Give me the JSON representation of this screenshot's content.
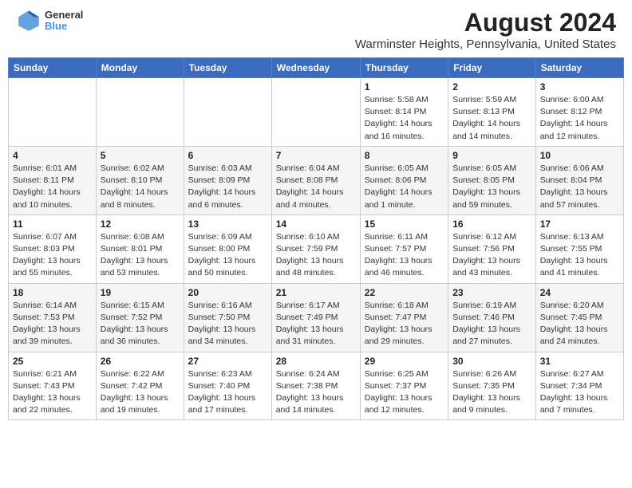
{
  "header": {
    "logo_line1": "General",
    "logo_line2": "Blue",
    "main_title": "August 2024",
    "subtitle": "Warminster Heights, Pennsylvania, United States"
  },
  "calendar": {
    "days_of_week": [
      "Sunday",
      "Monday",
      "Tuesday",
      "Wednesday",
      "Thursday",
      "Friday",
      "Saturday"
    ],
    "weeks": [
      [
        {
          "day": "",
          "info": ""
        },
        {
          "day": "",
          "info": ""
        },
        {
          "day": "",
          "info": ""
        },
        {
          "day": "",
          "info": ""
        },
        {
          "day": "1",
          "info": "Sunrise: 5:58 AM\nSunset: 8:14 PM\nDaylight: 14 hours\nand 16 minutes."
        },
        {
          "day": "2",
          "info": "Sunrise: 5:59 AM\nSunset: 8:13 PM\nDaylight: 14 hours\nand 14 minutes."
        },
        {
          "day": "3",
          "info": "Sunrise: 6:00 AM\nSunset: 8:12 PM\nDaylight: 14 hours\nand 12 minutes."
        }
      ],
      [
        {
          "day": "4",
          "info": "Sunrise: 6:01 AM\nSunset: 8:11 PM\nDaylight: 14 hours\nand 10 minutes."
        },
        {
          "day": "5",
          "info": "Sunrise: 6:02 AM\nSunset: 8:10 PM\nDaylight: 14 hours\nand 8 minutes."
        },
        {
          "day": "6",
          "info": "Sunrise: 6:03 AM\nSunset: 8:09 PM\nDaylight: 14 hours\nand 6 minutes."
        },
        {
          "day": "7",
          "info": "Sunrise: 6:04 AM\nSunset: 8:08 PM\nDaylight: 14 hours\nand 4 minutes."
        },
        {
          "day": "8",
          "info": "Sunrise: 6:05 AM\nSunset: 8:06 PM\nDaylight: 14 hours\nand 1 minute."
        },
        {
          "day": "9",
          "info": "Sunrise: 6:05 AM\nSunset: 8:05 PM\nDaylight: 13 hours\nand 59 minutes."
        },
        {
          "day": "10",
          "info": "Sunrise: 6:06 AM\nSunset: 8:04 PM\nDaylight: 13 hours\nand 57 minutes."
        }
      ],
      [
        {
          "day": "11",
          "info": "Sunrise: 6:07 AM\nSunset: 8:03 PM\nDaylight: 13 hours\nand 55 minutes."
        },
        {
          "day": "12",
          "info": "Sunrise: 6:08 AM\nSunset: 8:01 PM\nDaylight: 13 hours\nand 53 minutes."
        },
        {
          "day": "13",
          "info": "Sunrise: 6:09 AM\nSunset: 8:00 PM\nDaylight: 13 hours\nand 50 minutes."
        },
        {
          "day": "14",
          "info": "Sunrise: 6:10 AM\nSunset: 7:59 PM\nDaylight: 13 hours\nand 48 minutes."
        },
        {
          "day": "15",
          "info": "Sunrise: 6:11 AM\nSunset: 7:57 PM\nDaylight: 13 hours\nand 46 minutes."
        },
        {
          "day": "16",
          "info": "Sunrise: 6:12 AM\nSunset: 7:56 PM\nDaylight: 13 hours\nand 43 minutes."
        },
        {
          "day": "17",
          "info": "Sunrise: 6:13 AM\nSunset: 7:55 PM\nDaylight: 13 hours\nand 41 minutes."
        }
      ],
      [
        {
          "day": "18",
          "info": "Sunrise: 6:14 AM\nSunset: 7:53 PM\nDaylight: 13 hours\nand 39 minutes."
        },
        {
          "day": "19",
          "info": "Sunrise: 6:15 AM\nSunset: 7:52 PM\nDaylight: 13 hours\nand 36 minutes."
        },
        {
          "day": "20",
          "info": "Sunrise: 6:16 AM\nSunset: 7:50 PM\nDaylight: 13 hours\nand 34 minutes."
        },
        {
          "day": "21",
          "info": "Sunrise: 6:17 AM\nSunset: 7:49 PM\nDaylight: 13 hours\nand 31 minutes."
        },
        {
          "day": "22",
          "info": "Sunrise: 6:18 AM\nSunset: 7:47 PM\nDaylight: 13 hours\nand 29 minutes."
        },
        {
          "day": "23",
          "info": "Sunrise: 6:19 AM\nSunset: 7:46 PM\nDaylight: 13 hours\nand 27 minutes."
        },
        {
          "day": "24",
          "info": "Sunrise: 6:20 AM\nSunset: 7:45 PM\nDaylight: 13 hours\nand 24 minutes."
        }
      ],
      [
        {
          "day": "25",
          "info": "Sunrise: 6:21 AM\nSunset: 7:43 PM\nDaylight: 13 hours\nand 22 minutes."
        },
        {
          "day": "26",
          "info": "Sunrise: 6:22 AM\nSunset: 7:42 PM\nDaylight: 13 hours\nand 19 minutes."
        },
        {
          "day": "27",
          "info": "Sunrise: 6:23 AM\nSunset: 7:40 PM\nDaylight: 13 hours\nand 17 minutes."
        },
        {
          "day": "28",
          "info": "Sunrise: 6:24 AM\nSunset: 7:38 PM\nDaylight: 13 hours\nand 14 minutes."
        },
        {
          "day": "29",
          "info": "Sunrise: 6:25 AM\nSunset: 7:37 PM\nDaylight: 13 hours\nand 12 minutes."
        },
        {
          "day": "30",
          "info": "Sunrise: 6:26 AM\nSunset: 7:35 PM\nDaylight: 13 hours\nand 9 minutes."
        },
        {
          "day": "31",
          "info": "Sunrise: 6:27 AM\nSunset: 7:34 PM\nDaylight: 13 hours\nand 7 minutes."
        }
      ]
    ]
  }
}
